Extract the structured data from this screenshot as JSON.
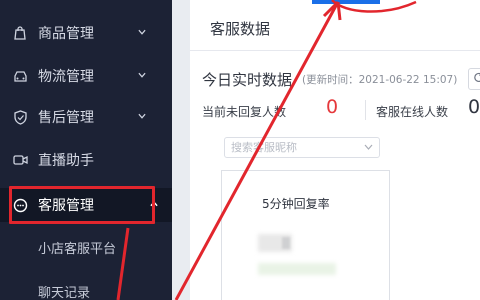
{
  "sidebar": {
    "items": [
      {
        "label": "商品管理",
        "icon": "bag-icon"
      },
      {
        "label": "物流管理",
        "icon": "car-icon"
      },
      {
        "label": "售后管理",
        "icon": "shield-icon"
      },
      {
        "label": "直播助手",
        "icon": "video-icon"
      },
      {
        "label": "客服管理",
        "icon": "headset-icon"
      }
    ],
    "subitems": [
      {
        "label": "小店客服平台"
      },
      {
        "label": "聊天记录"
      }
    ]
  },
  "main": {
    "section_title": "客服数据",
    "realtime_title": "今日实时数据",
    "update_time": "(更新时间：2021-06-22 15:07)",
    "metrics": [
      {
        "label": "当前未回复人数",
        "value": "0"
      },
      {
        "label": "客服在线人数",
        "value": "0"
      }
    ],
    "search": {
      "placeholder": "搜索客服昵称"
    },
    "card": {
      "title": "5分钟回复率"
    }
  },
  "colors": {
    "sidebar_bg": "#1c2235",
    "active_bg": "#121725",
    "highlight": "#e2262d",
    "red_value": "#e5383b",
    "accent_blue": "#1a6fe8"
  }
}
